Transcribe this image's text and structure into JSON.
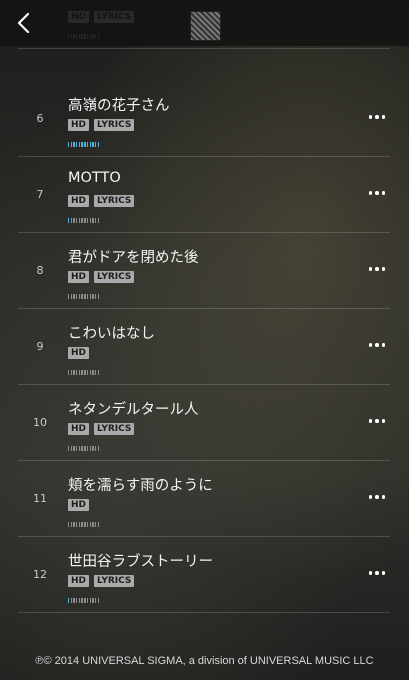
{
  "header": {
    "back_icon": "chevron-left-icon",
    "album_art": "album-art-thumbnail"
  },
  "tracks": [
    {
      "number": "",
      "title": "",
      "badges": [
        "HD",
        "LYRICS"
      ],
      "popularity": 0
    },
    {
      "number": "6",
      "title": "高嶺の花子さん",
      "badges": [
        "HD",
        "LYRICS"
      ],
      "popularity": 1.0
    },
    {
      "number": "7",
      "title": "MOTTO",
      "badges": [
        "HD",
        "LYRICS"
      ],
      "popularity": 0.1
    },
    {
      "number": "8",
      "title": "君がドアを閉めた後",
      "badges": [
        "HD",
        "LYRICS"
      ],
      "popularity": 0
    },
    {
      "number": "9",
      "title": "こわいはなし",
      "badges": [
        "HD"
      ],
      "popularity": 0
    },
    {
      "number": "10",
      "title": "ネタンデルタール人",
      "badges": [
        "HD",
        "LYRICS"
      ],
      "popularity": 0
    },
    {
      "number": "11",
      "title": "頬を濡らす雨のように",
      "badges": [
        "HD"
      ],
      "popularity": 0
    },
    {
      "number": "12",
      "title": "世田谷ラブストーリー",
      "badges": [
        "HD",
        "LYRICS"
      ],
      "popularity": 0.1
    }
  ],
  "footer": {
    "copyright": "℗© 2014 UNIVERSAL SIGMA, a division of UNIVERSAL MUSIC LLC"
  },
  "colors": {
    "accent": "#4db5e0",
    "divider": "#5a5a55"
  }
}
